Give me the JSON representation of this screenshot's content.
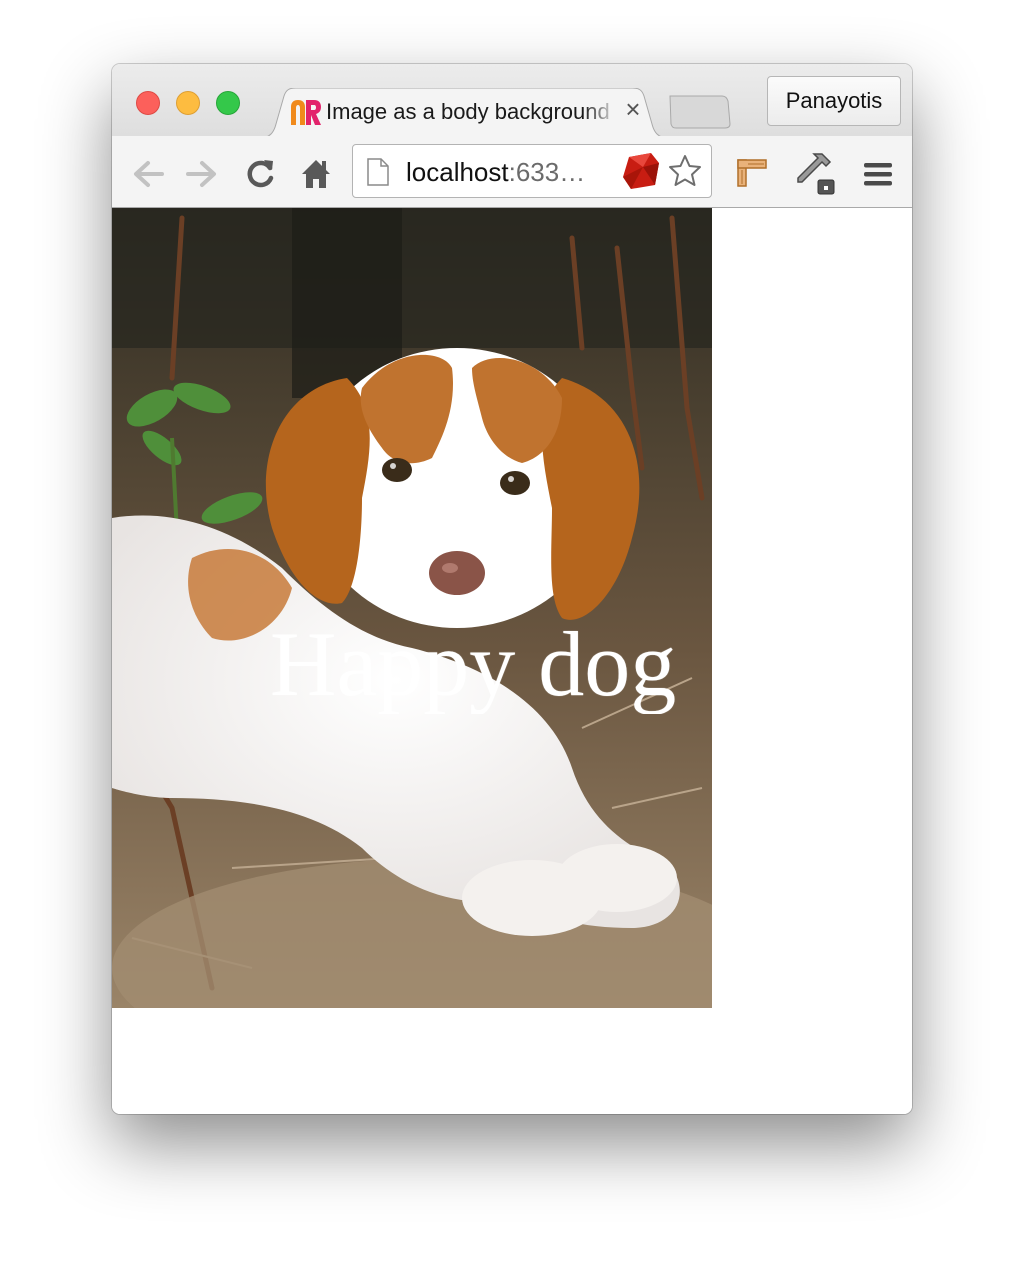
{
  "window": {
    "buttons": [
      "close",
      "minimize",
      "zoom"
    ]
  },
  "tab": {
    "favicon": "rubymine-logo-icon",
    "title": "Image as a body background",
    "close_label": "×"
  },
  "profile": {
    "name": "Panayotis"
  },
  "toolbar": {
    "icons": [
      "back-arrow-icon",
      "forward-arrow-icon",
      "reload-icon",
      "home-icon",
      "ruby-icon",
      "star-icon",
      "extension-icon",
      "eyedropper-icon",
      "menu-icon"
    ]
  },
  "omnibox": {
    "host": "localhost",
    "port": ":633…"
  },
  "page": {
    "background_image": "puppy-photo",
    "headline": "Happy dog"
  },
  "colors": {
    "traffic_red": "#fc605b",
    "traffic_yellow": "#fdbc40",
    "traffic_green": "#34c84a",
    "headline": "#ffffff"
  }
}
